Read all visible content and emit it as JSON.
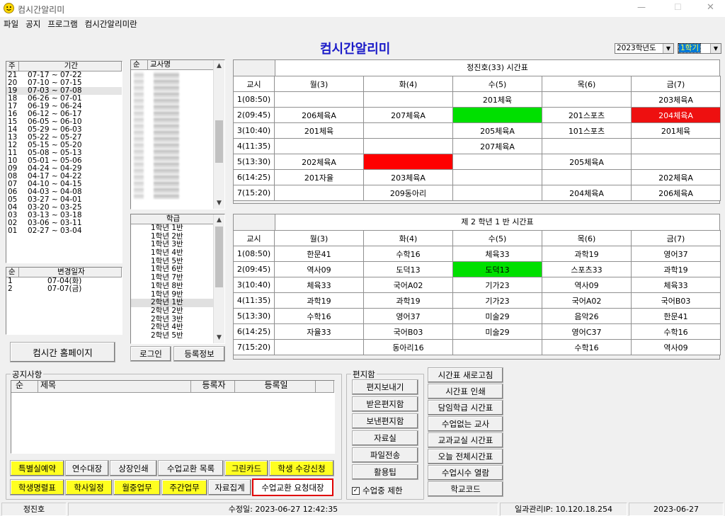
{
  "window": {
    "title": "컴시간알리미",
    "min_label": "—",
    "max_label": "☐",
    "close_label": "✕"
  },
  "menu": [
    "파일",
    "공지",
    "프로그램",
    "컴시간알리미란"
  ],
  "header": {
    "app_title": "컴시간알리미",
    "year_select": "2023학년도",
    "term_select": "1학기"
  },
  "week_list": {
    "col_num": "주",
    "col_period": "기간",
    "rows": [
      [
        "21",
        "07-17 ~ 07-22"
      ],
      [
        "20",
        "07-10 ~ 07-15"
      ],
      [
        "19",
        "07-03 ~ 07-08"
      ],
      [
        "18",
        "06-26 ~ 07-01"
      ],
      [
        "17",
        "06-19 ~ 06-24"
      ],
      [
        "16",
        "06-12 ~ 06-17"
      ],
      [
        "15",
        "06-05 ~ 06-10"
      ],
      [
        "14",
        "05-29 ~ 06-03"
      ],
      [
        "13",
        "05-22 ~ 05-27"
      ],
      [
        "12",
        "05-15 ~ 05-20"
      ],
      [
        "11",
        "05-08 ~ 05-13"
      ],
      [
        "10",
        "05-01 ~ 05-06"
      ],
      [
        "09",
        "04-24 ~ 04-29"
      ],
      [
        "08",
        "04-17 ~ 04-22"
      ],
      [
        "07",
        "04-10 ~ 04-15"
      ],
      [
        "06",
        "04-03 ~ 04-08"
      ],
      [
        "05",
        "03-27 ~ 04-01"
      ],
      [
        "04",
        "03-20 ~ 03-25"
      ],
      [
        "03",
        "03-13 ~ 03-18"
      ],
      [
        "02",
        "03-06 ~ 03-11"
      ],
      [
        "01",
        "02-27 ~ 03-04"
      ]
    ]
  },
  "change_list": {
    "col_num": "순",
    "col_date": "변경일자",
    "rows": [
      [
        "1",
        "07-04(화)"
      ],
      [
        "2",
        "07-07(금)"
      ]
    ]
  },
  "teacher_list": {
    "col_num": "순",
    "col_name": "교사명"
  },
  "class_list": {
    "header": "학급",
    "rows": [
      "1학년 1반",
      "1학년 2반",
      "1학년 3반",
      "1학년 4반",
      "1학년 5반",
      "1학년 6반",
      "1학년 7반",
      "1학년 8반",
      "1학년 9반",
      "2학년 1반",
      "2학년 2반",
      "2학년 3반",
      "2학년 4반",
      "2학년 5반"
    ]
  },
  "buttons": {
    "homepage": "컴시간 홈페이지",
    "login": "로그인",
    "register": "등록정보"
  },
  "teacher_tt": {
    "title": "정진호(33) 시간표",
    "headers": [
      "교시",
      "월(3)",
      "화(4)",
      "수(5)",
      "목(6)",
      "금(7)"
    ],
    "rows": [
      [
        "1(08:50)",
        "",
        "",
        "201체육",
        "",
        "203체육A"
      ],
      [
        "2(09:45)",
        "206체육A",
        "207체육A",
        "",
        "201스포츠",
        "204체육A"
      ],
      [
        "3(10:40)",
        "201체육",
        "",
        "205체육A",
        "101스포츠",
        "201체육"
      ],
      [
        "4(11:35)",
        "",
        "",
        "207체육A",
        "",
        ""
      ],
      [
        "5(13:30)",
        "202체육A",
        "",
        "",
        "205체육A",
        ""
      ],
      [
        "6(14:25)",
        "201자율",
        "203체육A",
        "",
        "",
        "202체육A"
      ],
      [
        "7(15:20)",
        "",
        "209동아리",
        "",
        "204체육A",
        "206체육A"
      ]
    ]
  },
  "class_tt": {
    "title": "제 2 학년 1 반 시간표",
    "headers": [
      "교시",
      "월(3)",
      "화(4)",
      "수(5)",
      "목(6)",
      "금(7)"
    ],
    "rows": [
      [
        "1(08:50)",
        "한문41",
        "수학16",
        "체육33",
        "과학19",
        "영어37"
      ],
      [
        "2(09:45)",
        "역사09",
        "도덕13",
        "도덕13",
        "스포츠33",
        "과학19"
      ],
      [
        "3(10:40)",
        "체육33",
        "국어A02",
        "기가23",
        "역사09",
        "체육33"
      ],
      [
        "4(11:35)",
        "과학19",
        "과학19",
        "기가23",
        "국어A02",
        "국어B03"
      ],
      [
        "5(13:30)",
        "수학16",
        "영어37",
        "미술29",
        "음악26",
        "한문41"
      ],
      [
        "6(14:25)",
        "자율33",
        "국어B03",
        "미술29",
        "영어C37",
        "수학16"
      ],
      [
        "7(15:20)",
        "",
        "동아리16",
        "",
        "수학16",
        "역사09"
      ]
    ]
  },
  "notice": {
    "label": "공지사항",
    "col_num": "순",
    "col_title": "제목",
    "col_author": "등록자",
    "col_date": "등록일"
  },
  "bottom_buttons": {
    "row1": [
      "특별실예약",
      "연수대장",
      "상장인쇄",
      "수업교환 목록",
      "그린카드",
      "학생 수강신청"
    ],
    "row2": [
      "학생명렬표",
      "학사일정",
      "월중업무",
      "주간업무",
      "자료집계",
      "수업교환 요청대장"
    ]
  },
  "mailbox": {
    "label": "편지함",
    "buttons": [
      "편지보내기",
      "받은편지함",
      "보낸편지함",
      "자료실",
      "파일전송",
      "활용팁"
    ],
    "checkbox_label": "수업중 제한",
    "checked": true
  },
  "right_buttons": [
    "시간표 새로고침",
    "시간표 인쇄",
    "담임학급 시간표",
    "수업없는 교사",
    "교과교실 시간표",
    "오늘 전체시간표",
    "수업시수 열람",
    "학교코드"
  ],
  "status": {
    "user": "정진호",
    "modified": "수정일: 2023-06-27 12:42:35",
    "ip": "일과관리IP: 10.120.18.254",
    "date": "2023-06-27"
  },
  "colors": {
    "green": "#00e000",
    "red": "#ee1010",
    "yellow": "#ffff20",
    "title_blue": "#1a1ac8"
  }
}
